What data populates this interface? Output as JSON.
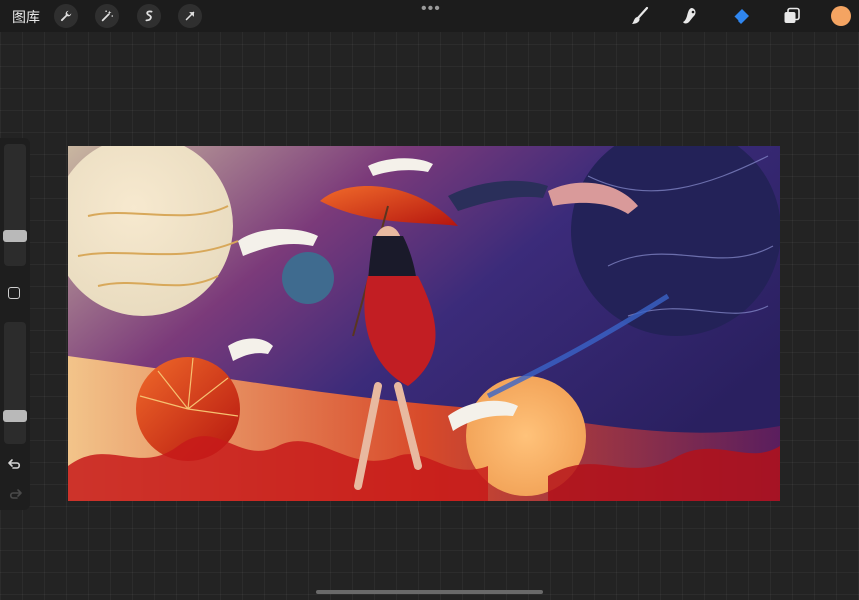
{
  "topbar": {
    "gallery_label": "图库",
    "tools_left": [
      {
        "icon": "wrench-icon"
      },
      {
        "icon": "magic-wand-icon"
      },
      {
        "icon": "selection-icon"
      },
      {
        "icon": "transform-arrow-icon"
      }
    ],
    "more_label": "•••",
    "tools_right": [
      {
        "icon": "brush-icon"
      },
      {
        "icon": "smudge-icon"
      },
      {
        "icon": "eraser-icon"
      },
      {
        "icon": "layers-icon"
      }
    ],
    "current_color": "#f4a462",
    "active_tool_color": "#2f86f0"
  },
  "sidebar": {
    "brush_size_level": 0.22,
    "opacity_level": 0.2,
    "undo_icon": "undo-icon",
    "redo_icon": "redo-icon"
  },
  "canvas": {
    "artwork": "illustration"
  }
}
